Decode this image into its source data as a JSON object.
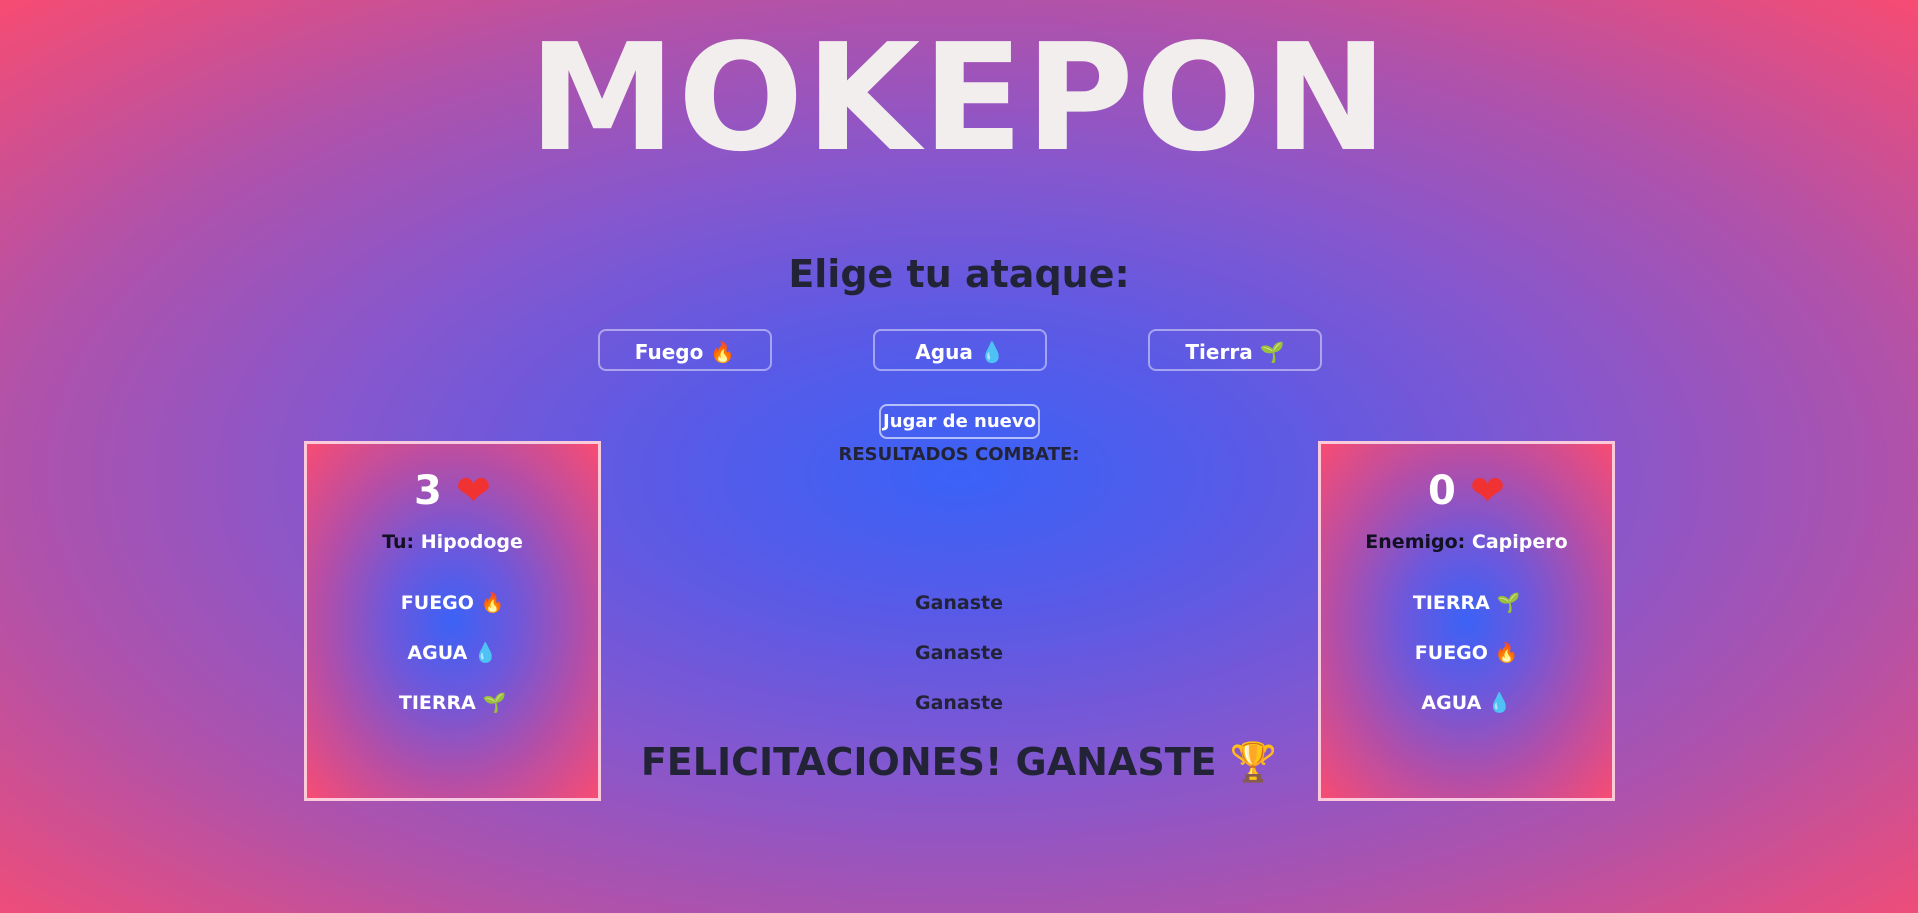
{
  "title": "MOKEPON",
  "subtitle": "Elige tu ataque:",
  "attack_buttons": [
    {
      "label": "Fuego",
      "icon": "🔥"
    },
    {
      "label": "Agua",
      "icon": "💧"
    },
    {
      "label": "Tierra",
      "icon": "🌱"
    }
  ],
  "restart_label": "Jugar de nuevo",
  "results_title": "RESULTADOS COMBATE:",
  "player": {
    "lives": "3",
    "heart": "❤",
    "label": "Tu:",
    "pet": "Hipodoge",
    "attacks": [
      {
        "name": "FUEGO",
        "icon": "🔥"
      },
      {
        "name": "AGUA",
        "icon": "💧"
      },
      {
        "name": "TIERRA",
        "icon": "🌱"
      }
    ]
  },
  "enemy": {
    "lives": "0",
    "heart": "❤",
    "label": "Enemigo:",
    "pet": "Capipero",
    "attacks": [
      {
        "name": "TIERRA",
        "icon": "🌱"
      },
      {
        "name": "FUEGO",
        "icon": "🔥"
      },
      {
        "name": "AGUA",
        "icon": "💧"
      }
    ]
  },
  "results": [
    "Ganaste",
    "Ganaste",
    "Ganaste"
  ],
  "final_message": "FELICITACIONES! GANASTE",
  "final_icon": "🏆",
  "colors": {
    "title": "#f2eeee",
    "dark_text": "#232337",
    "heart": "#f03232",
    "bg_center": "#3a62f7",
    "bg_edge": "#f74c72"
  }
}
